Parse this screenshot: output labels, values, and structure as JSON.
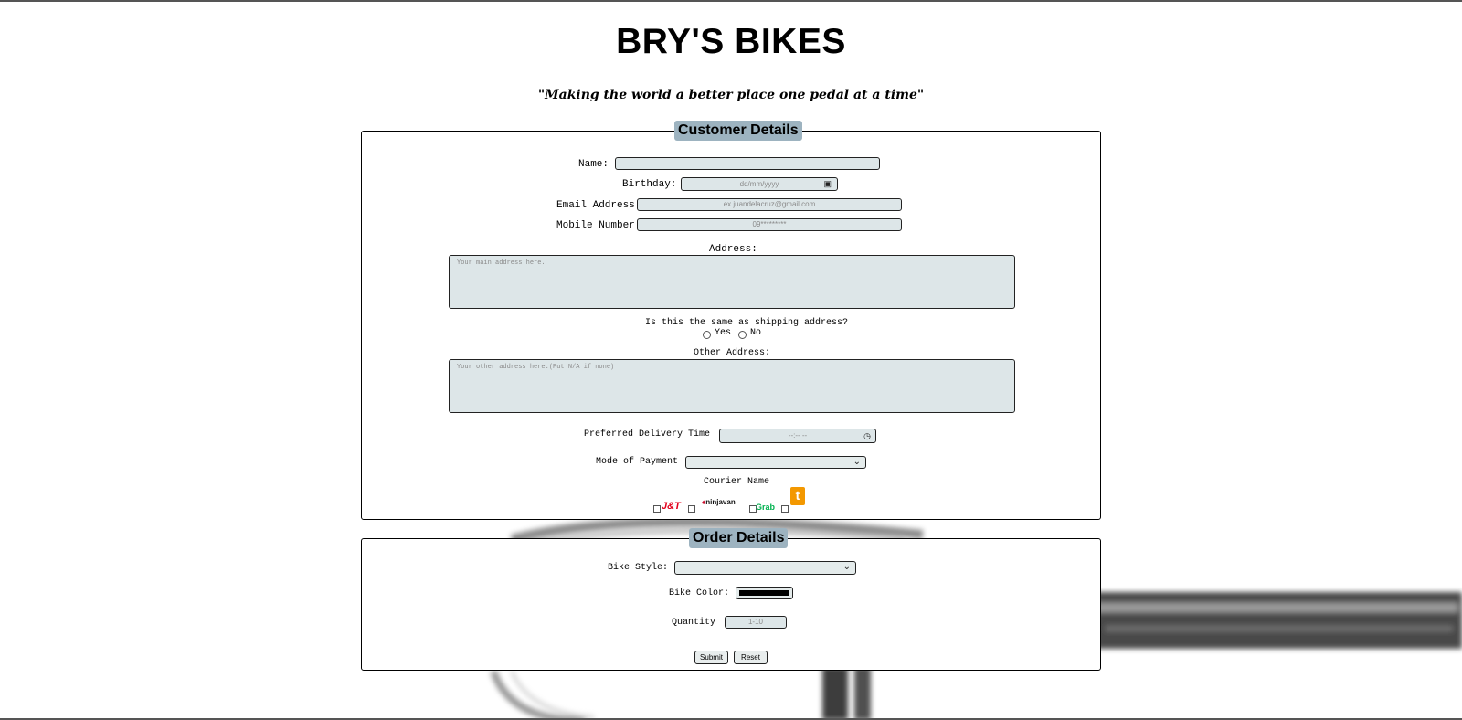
{
  "header": {
    "title": "BRY'S BIKES",
    "tagline": "\"Making the world a better place one pedal at a time\""
  },
  "customer": {
    "legend": "Customer Details",
    "name_label": "Name:",
    "birthday_label": "Birthday:",
    "birthday_placeholder": "dd/mm/yyyy",
    "email_label": "Email Address",
    "email_placeholder": "ex.juandelacruz@gmail.com",
    "mobile_label": "Mobile Number",
    "mobile_placeholder": "09*********",
    "address_label": "Address:",
    "address_placeholder": "Your main address here.",
    "shipping_question": "Is this the same as shipping address?",
    "yes_label": "Yes",
    "no_label": "No",
    "other_address_label": "Other Address:",
    "other_address_placeholder": "Your other address here.(Put N/A if none)",
    "delivery_label": "Preferred Delivery Time",
    "delivery_placeholder": "--:-- --",
    "payment_label": "Mode of Payment",
    "courier_label": "Courier Name",
    "couriers": [
      "J&T",
      "ninjavan",
      "Grab",
      "t"
    ]
  },
  "order": {
    "legend": "Order Details",
    "style_label": "Bike Style:",
    "color_label": "Bike Color:",
    "color_value": "#000000",
    "quantity_label": "Quantity",
    "quantity_placeholder": "1-10",
    "submit_label": "Submit",
    "reset_label": "Reset"
  },
  "icons": {
    "calendar": "calendar-icon",
    "clock": "clock-icon",
    "chevron": "chevron-down-icon"
  },
  "colors": {
    "legend_bg": "#9db3c0",
    "field_bg": "#dde6e8",
    "jt_red": "#e3001b",
    "grab_green": "#00b14f",
    "lalamove_orange": "#f39800"
  }
}
